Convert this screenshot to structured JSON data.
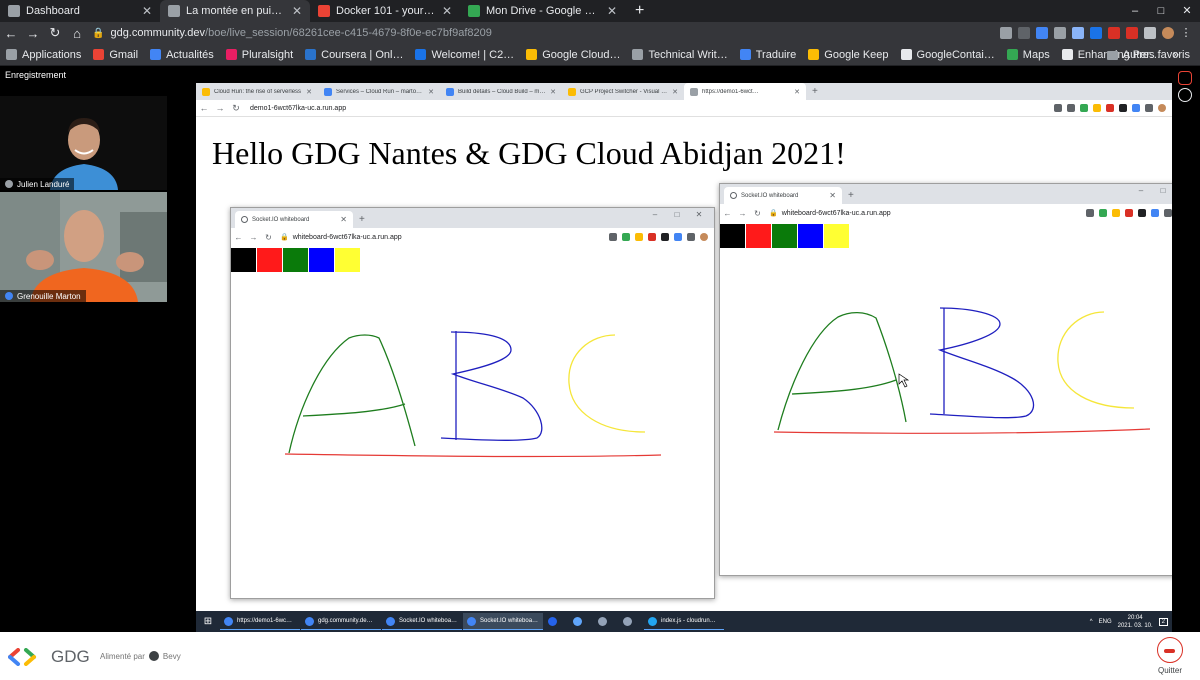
{
  "outer_browser": {
    "tabs": [
      {
        "label": "Dashboard",
        "color": "#9aa0a6"
      },
      {
        "label": "La montée en puissan…",
        "color": "#9aa0a6",
        "active": true
      },
      {
        "label": "Docker 101 - your first do…",
        "color": "#ea4335"
      },
      {
        "label": "Mon Drive - Google Drive",
        "color": "#34a853"
      }
    ],
    "new_tab": "+",
    "window_controls": [
      "–",
      "□",
      "✕"
    ],
    "url_host": "gdg.community.dev",
    "url_path": "/boe/live_session/68261cee-c415-4679-8f0e-ec7bf9af8209",
    "bookmarks": [
      {
        "label": "Applications",
        "color": "#9aa0a6"
      },
      {
        "label": "Gmail",
        "color": "#ea4335"
      },
      {
        "label": "Actualités",
        "color": "#4285f4"
      },
      {
        "label": "Pluralsight",
        "color": "#e91e63"
      },
      {
        "label": "Coursera | Onl…",
        "color": "#2a73cc"
      },
      {
        "label": "Welcome! | C2…",
        "color": "#1a73e8"
      },
      {
        "label": "Google Cloud…",
        "color": "#fbbc05"
      },
      {
        "label": "Technical Writ…",
        "color": "#9aa0a6"
      },
      {
        "label": "Traduire",
        "color": "#4285f4"
      },
      {
        "label": "Google Keep",
        "color": "#fbbc05"
      },
      {
        "label": "GoogleContai…",
        "color": "#e8eaed"
      },
      {
        "label": "Maps",
        "color": "#34a853"
      },
      {
        "label": "Enhancing Per…",
        "color": "#e8eaed"
      }
    ],
    "bookmarks_more": "»",
    "other_bookmarks": "Autres favoris"
  },
  "session": {
    "recording_label": "Enregistrement",
    "participants": [
      {
        "name": "Julien Landuré"
      },
      {
        "name": "Grenouille Marton"
      }
    ]
  },
  "shared_screen": {
    "tabs": [
      {
        "label": "Cloud Run: the rise of serverless",
        "color": "#fbbc05"
      },
      {
        "label": "Services – Cloud Run – marton…",
        "color": "#4285f4"
      },
      {
        "label": "Build details – Cloud Build – mu…",
        "color": "#4285f4"
      },
      {
        "label": "GCP Project Switcher - Visual St…",
        "color": "#fbbc05"
      },
      {
        "label": "https://demo1-6wct…",
        "color": "#9aa0a6",
        "active": true
      }
    ],
    "url": "demo1-6wct67lka-uc.a.run.app",
    "headline": "Hello GDG Nantes & GDG Cloud Abidjan 2021!",
    "whiteboards": [
      {
        "tab_title": "Socket.IO whiteboard",
        "url": "whiteboard-6wct67lka-uc.a.run.app"
      },
      {
        "tab_title": "Socket.IO whiteboard",
        "url": "whiteboard-6wct67lka-uc.a.run.app"
      }
    ],
    "swatch_colors": [
      "#000000",
      "#ff1a1a",
      "#0a7a0a",
      "#0000ff",
      "#ffff33"
    ],
    "stroke_colors": {
      "a": "#1e7d1e",
      "b": "#1f1fbf",
      "c": "#f5e63a",
      "line": "#e53935"
    },
    "taskbar": {
      "items": [
        {
          "label": "https://demo1-6wc…",
          "color": "#4285f4"
        },
        {
          "label": "gdg.community.de…",
          "color": "#4285f4"
        },
        {
          "label": "Socket.IO whiteboa…",
          "color": "#4285f4"
        },
        {
          "label": "Socket.IO whiteboa…",
          "color": "#4285f4",
          "active": true
        },
        {
          "label": "",
          "color": "#2563eb"
        },
        {
          "label": "",
          "color": "#60a5fa"
        },
        {
          "label": "",
          "color": "#94a3b8"
        },
        {
          "label": "",
          "color": "#94a3b8"
        },
        {
          "label": "index.js - cloudrun…",
          "color": "#22a6f2"
        }
      ],
      "lang": "ENG",
      "time": "20:04",
      "date": "2021. 03. 10.",
      "notif": "2"
    }
  },
  "footer": {
    "brand": "GDG",
    "powered_by": "Alimenté par",
    "platform": "Bevy",
    "quit_label": "Quitter"
  }
}
